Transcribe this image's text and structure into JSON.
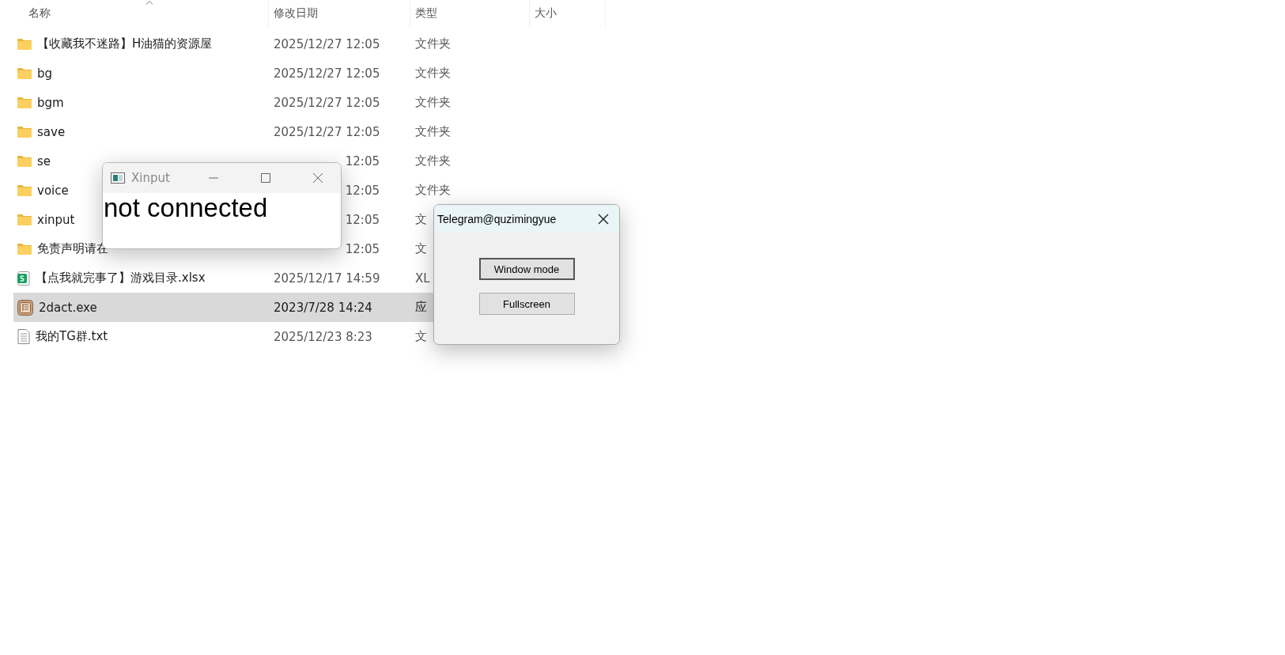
{
  "explorer": {
    "columns": [
      {
        "label": "名称",
        "sorted": true
      },
      {
        "label": "修改日期",
        "sorted": false
      },
      {
        "label": "类型",
        "sorted": false
      },
      {
        "label": "大小",
        "sorted": false
      }
    ],
    "rows": [
      {
        "kind": "folder",
        "name": "【收藏我不迷路】H油猫的资源屋",
        "date": "2025/12/27 12:05",
        "type": "文件夹",
        "selected": false
      },
      {
        "kind": "folder",
        "name": "bg",
        "date": "2025/12/27 12:05",
        "type": "文件夹",
        "selected": false
      },
      {
        "kind": "folder",
        "name": "bgm",
        "date": "2025/12/27 12:05",
        "type": "文件夹",
        "selected": false
      },
      {
        "kind": "folder",
        "name": "save",
        "date": "2025/12/27 12:05",
        "type": "文件夹",
        "selected": false
      },
      {
        "kind": "folder",
        "name": "se",
        "date_tail": "12:05",
        "type": "文件夹",
        "selected": false
      },
      {
        "kind": "folder",
        "name": "voice",
        "date_tail": "12:05",
        "type": "文件夹",
        "selected": false
      },
      {
        "kind": "folder",
        "name": "xinput",
        "date_tail": "12:05",
        "type": "文",
        "selected": false
      },
      {
        "kind": "folder",
        "name": "免责声明请在",
        "date_tail": "12:05",
        "type": "文",
        "selected": false
      },
      {
        "kind": "sheet",
        "name": "【点我就完事了】游戏目录.xlsx",
        "date": "2025/12/17 14:59",
        "type": "XL",
        "selected": false
      },
      {
        "kind": "exe",
        "name": "2dact.exe",
        "date": "2023/7/28 14:24",
        "type": "应",
        "selected": true
      },
      {
        "kind": "text",
        "name": "我的TG群.txt",
        "date": "2025/12/23 8:23",
        "type": "文",
        "selected": false
      }
    ]
  },
  "xinput_window": {
    "title": "Xinput",
    "message": "not connected"
  },
  "telegram_window": {
    "title": "Telegram@quzimingyue",
    "buttons": [
      {
        "label": "Window mode",
        "focused": true
      },
      {
        "label": "Fullscreen",
        "focused": false
      }
    ]
  }
}
